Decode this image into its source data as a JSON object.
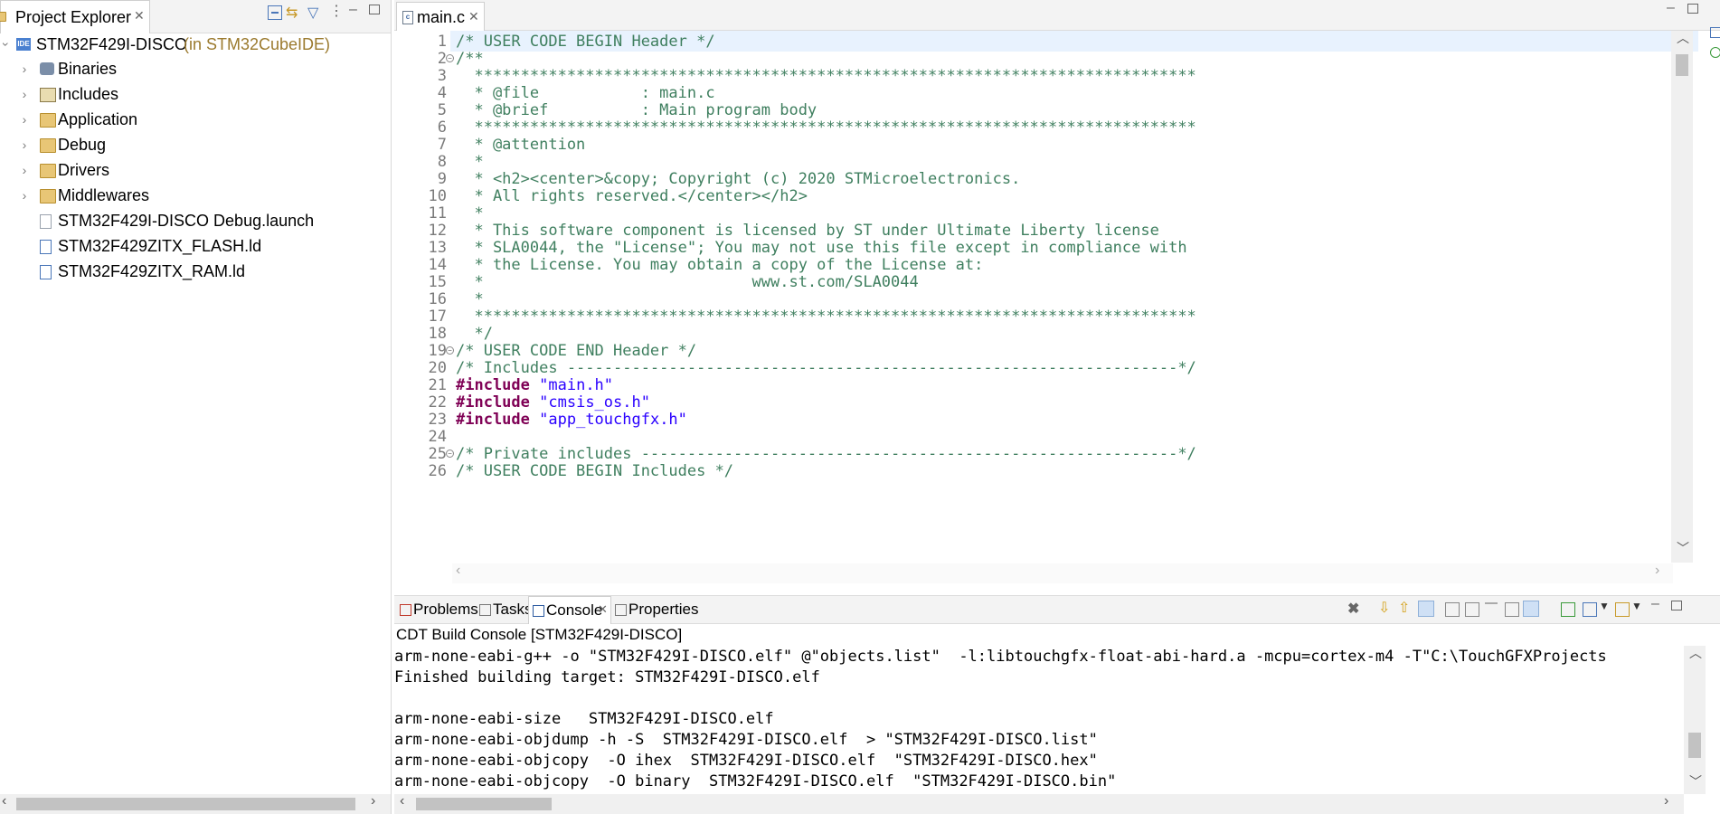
{
  "project_explorer": {
    "tab_label": "Project Explorer",
    "project": {
      "name": "STM32F429I-DISCO",
      "suffix": "(in STM32CubeIDE)"
    },
    "items": [
      {
        "label": "Binaries",
        "kind": "binaries",
        "expandable": true
      },
      {
        "label": "Includes",
        "kind": "includes",
        "expandable": true
      },
      {
        "label": "Application",
        "kind": "folder",
        "expandable": true
      },
      {
        "label": "Debug",
        "kind": "folder",
        "expandable": true
      },
      {
        "label": "Drivers",
        "kind": "folder",
        "expandable": true
      },
      {
        "label": "Middlewares",
        "kind": "folder",
        "expandable": true
      },
      {
        "label": "STM32F429I-DISCO Debug.launch",
        "kind": "file",
        "expandable": false
      },
      {
        "label": "STM32F429ZITX_FLASH.ld",
        "kind": "ld-file",
        "expandable": false
      },
      {
        "label": "STM32F429ZITX_RAM.ld",
        "kind": "ld-file",
        "expandable": false
      }
    ]
  },
  "editor": {
    "tab_label": "main.c",
    "lines": [
      {
        "n": "1",
        "fold": false,
        "parts": [
          {
            "t": "/* USER CODE BEGIN Header */",
            "c": "cm"
          }
        ]
      },
      {
        "n": "2",
        "fold": true,
        "parts": [
          {
            "t": "/**",
            "c": "cm"
          }
        ]
      },
      {
        "n": "3",
        "fold": false,
        "parts": [
          {
            "t": "  ******************************************************************************",
            "c": "cm"
          }
        ]
      },
      {
        "n": "4",
        "fold": false,
        "parts": [
          {
            "t": "  * @file           : main.c",
            "c": "cm"
          }
        ]
      },
      {
        "n": "5",
        "fold": false,
        "parts": [
          {
            "t": "  * @brief          : Main program body",
            "c": "cm"
          }
        ]
      },
      {
        "n": "6",
        "fold": false,
        "parts": [
          {
            "t": "  ******************************************************************************",
            "c": "cm"
          }
        ]
      },
      {
        "n": "7",
        "fold": false,
        "parts": [
          {
            "t": "  * @attention",
            "c": "cm"
          }
        ]
      },
      {
        "n": "8",
        "fold": false,
        "parts": [
          {
            "t": "  *",
            "c": "cm"
          }
        ]
      },
      {
        "n": "9",
        "fold": false,
        "parts": [
          {
            "t": "  * <h2><center>&copy; Copyright (c) 2020 STMicroelectronics.",
            "c": "cm"
          }
        ]
      },
      {
        "n": "10",
        "fold": false,
        "parts": [
          {
            "t": "  * All rights reserved.</center></h2>",
            "c": "cm"
          }
        ]
      },
      {
        "n": "11",
        "fold": false,
        "parts": [
          {
            "t": "  *",
            "c": "cm"
          }
        ]
      },
      {
        "n": "12",
        "fold": false,
        "parts": [
          {
            "t": "  * This software component is licensed by ST under Ultimate Liberty license",
            "c": "cm"
          }
        ]
      },
      {
        "n": "13",
        "fold": false,
        "parts": [
          {
            "t": "  * SLA0044, the \"License\"; You may not use this file except in compliance with",
            "c": "cm"
          }
        ]
      },
      {
        "n": "14",
        "fold": false,
        "parts": [
          {
            "t": "  * the License. You may obtain a copy of the License at:",
            "c": "cm"
          }
        ]
      },
      {
        "n": "15",
        "fold": false,
        "parts": [
          {
            "t": "  *                             www.st.com/SLA0044",
            "c": "cm"
          }
        ]
      },
      {
        "n": "16",
        "fold": false,
        "parts": [
          {
            "t": "  *",
            "c": "cm"
          }
        ]
      },
      {
        "n": "17",
        "fold": false,
        "parts": [
          {
            "t": "  ******************************************************************************",
            "c": "cm"
          }
        ]
      },
      {
        "n": "18",
        "fold": false,
        "parts": [
          {
            "t": "  */",
            "c": "cm"
          }
        ]
      },
      {
        "n": "19",
        "fold": true,
        "parts": [
          {
            "t": "/* USER CODE END Header */",
            "c": "cm"
          }
        ]
      },
      {
        "n": "20",
        "fold": false,
        "parts": [
          {
            "t": "/* Includes ------------------------------------------------------------------*/",
            "c": "cm"
          }
        ]
      },
      {
        "n": "21",
        "fold": false,
        "parts": [
          {
            "t": "#include",
            "c": "kw"
          },
          {
            "t": " ",
            "c": ""
          },
          {
            "t": "\"main.h\"",
            "c": "str"
          }
        ]
      },
      {
        "n": "22",
        "fold": false,
        "parts": [
          {
            "t": "#include",
            "c": "kw"
          },
          {
            "t": " ",
            "c": ""
          },
          {
            "t": "\"cmsis_os.h\"",
            "c": "str"
          }
        ]
      },
      {
        "n": "23",
        "fold": false,
        "parts": [
          {
            "t": "#include",
            "c": "kw"
          },
          {
            "t": " ",
            "c": ""
          },
          {
            "t": "\"app_touchgfx.h\"",
            "c": "str"
          }
        ]
      },
      {
        "n": "24",
        "fold": false,
        "parts": []
      },
      {
        "n": "25",
        "fold": true,
        "parts": [
          {
            "t": "/* Private includes ----------------------------------------------------------*/",
            "c": "cm"
          }
        ]
      },
      {
        "n": "26",
        "fold": false,
        "parts": [
          {
            "t": "/* USER CODE BEGIN Includes */",
            "c": "cm"
          }
        ]
      }
    ]
  },
  "bottom_panel": {
    "tabs": [
      {
        "label": "Problems",
        "icon": "problems-icon",
        "active": false
      },
      {
        "label": "Tasks",
        "icon": "tasks-icon",
        "active": false
      },
      {
        "label": "Console",
        "icon": "console-icon",
        "active": true
      },
      {
        "label": "Properties",
        "icon": "properties-icon",
        "active": false
      }
    ],
    "console_title": "CDT Build Console [STM32F429I-DISCO]",
    "console_lines": [
      "arm-none-eabi-g++ -o \"STM32F429I-DISCO.elf\" @\"objects.list\"  -l:libtouchgfx-float-abi-hard.a -mcpu=cortex-m4 -T\"C:\\TouchGFXProjects",
      "Finished building target: STM32F429I-DISCO.elf",
      "",
      "arm-none-eabi-size   STM32F429I-DISCO.elf",
      "arm-none-eabi-objdump -h -S  STM32F429I-DISCO.elf  > \"STM32F429I-DISCO.list\"",
      "arm-none-eabi-objcopy  -O ihex  STM32F429I-DISCO.elf  \"STM32F429I-DISCO.hex\"",
      "arm-none-eabi-objcopy  -O binary  STM32F429I-DISCO.elf  \"STM32F429I-DISCO.bin\""
    ]
  },
  "colors": {
    "comment": "#3f7f5f",
    "keyword": "#7f0055",
    "string": "#2a00ff",
    "project_suffix": "#9b7a2e",
    "active_line": "#e8f2fe"
  }
}
